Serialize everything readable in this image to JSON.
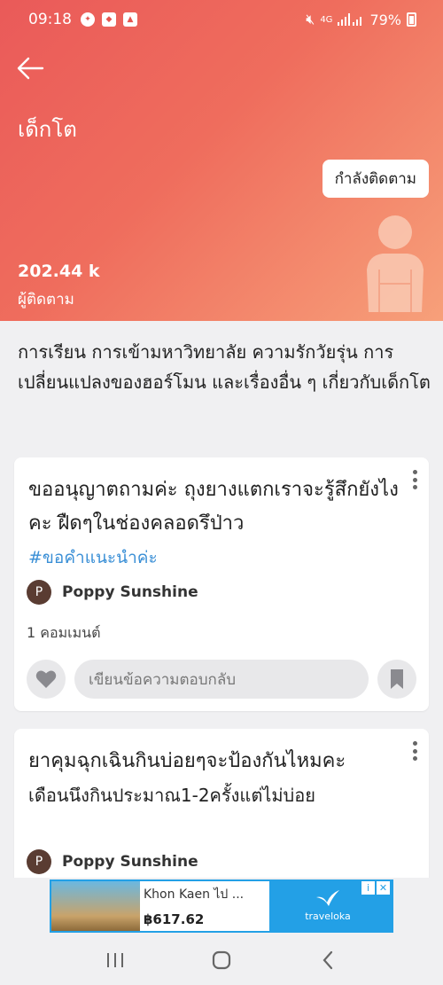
{
  "status_bar": {
    "time": "09:18",
    "network": "4G",
    "battery": "79%"
  },
  "header": {
    "title": "เด็กโต",
    "follow_button": "กำลังติดตาม",
    "followers_count": "202.44 k",
    "followers_label": "ผู้ติดตาม"
  },
  "description": "การเรียน การเข้ามหาวิทยาลัย ความรักวัยรุ่น การเปลี่ยนแปลงของฮอร์โมน และเรื่องอื่น ๆ เกี่ยวกับเด็กโต",
  "posts": [
    {
      "title": "ขออนุญาตถามค่ะ ถุงยางแตกเราจะรู้สึกยังไงคะ ฝืดๆในช่องคลอดรึป่าว",
      "hashtag": "#ขอคำแนะนำค่ะ",
      "author_initial": "P",
      "author": "Poppy Sunshine",
      "comments": "1 คอมเมนต์",
      "reply_placeholder": "เขียนข้อความตอบกลับ"
    },
    {
      "title": "ยาคุมฉุกเฉินกินบ่อยๆจะป้องกันไหมคะ",
      "body": "เดือนนึงกินประมาณ1-2ครั้งแต่ไม่บ่อย",
      "author_initial": "P",
      "author": "Poppy Sunshine"
    }
  ],
  "ad": {
    "destination": "Khon Kaen ไป ...",
    "price": "฿617.62",
    "brand": "traveloka",
    "info_icon": "i",
    "close_icon": "✕"
  },
  "icons": {
    "back": "arrow-left-icon",
    "like": "heart-icon",
    "bookmark": "bookmark-icon",
    "nav_recent": "recent-apps-icon",
    "nav_home": "home-icon",
    "nav_back": "chevron-left-icon"
  },
  "colors": {
    "header_start": "#ea5a59",
    "header_end": "#f7a07a",
    "hashtag": "#3a8fd6",
    "ad_bg": "#23a0e6"
  }
}
